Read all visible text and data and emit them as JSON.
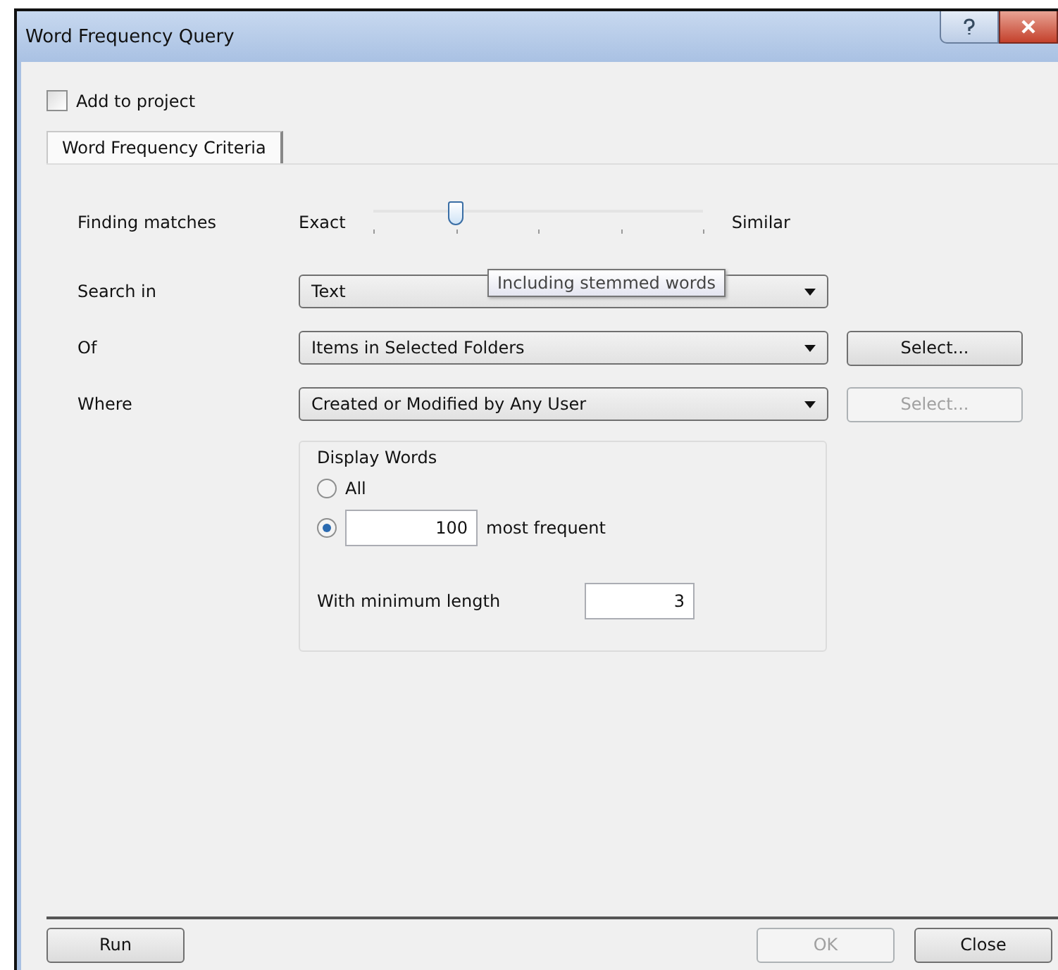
{
  "window": {
    "title": "Word Frequency Query"
  },
  "add_to_project": {
    "label": "Add to project",
    "checked": false
  },
  "tabs": [
    {
      "label": "Word Frequency Criteria",
      "selected": true
    }
  ],
  "finding_matches": {
    "label": "Finding matches",
    "min_label": "Exact",
    "max_label": "Similar",
    "level": 0.25,
    "tooltip": "Including stemmed words"
  },
  "criteria": [
    {
      "label": "Search in",
      "value": "Text"
    },
    {
      "label": "Of",
      "value": "Items in Selected Folders",
      "button": {
        "label": "Select...",
        "disabled": false
      }
    },
    {
      "label": "Where",
      "value": "Created or Modified by Any User",
      "button": {
        "label": "Select...",
        "disabled": true
      }
    }
  ],
  "display_words": {
    "title": "Display Words",
    "options": [
      {
        "label": "All",
        "selected": false
      },
      {
        "value": "100",
        "label": "most frequent",
        "selected": true
      }
    ],
    "min_length": {
      "label": "With minimum length",
      "value": "3"
    }
  },
  "buttons": [
    {
      "label": "Run",
      "disabled": false
    },
    {
      "label": "OK",
      "disabled": true
    },
    {
      "label": "Close",
      "disabled": false
    }
  ]
}
